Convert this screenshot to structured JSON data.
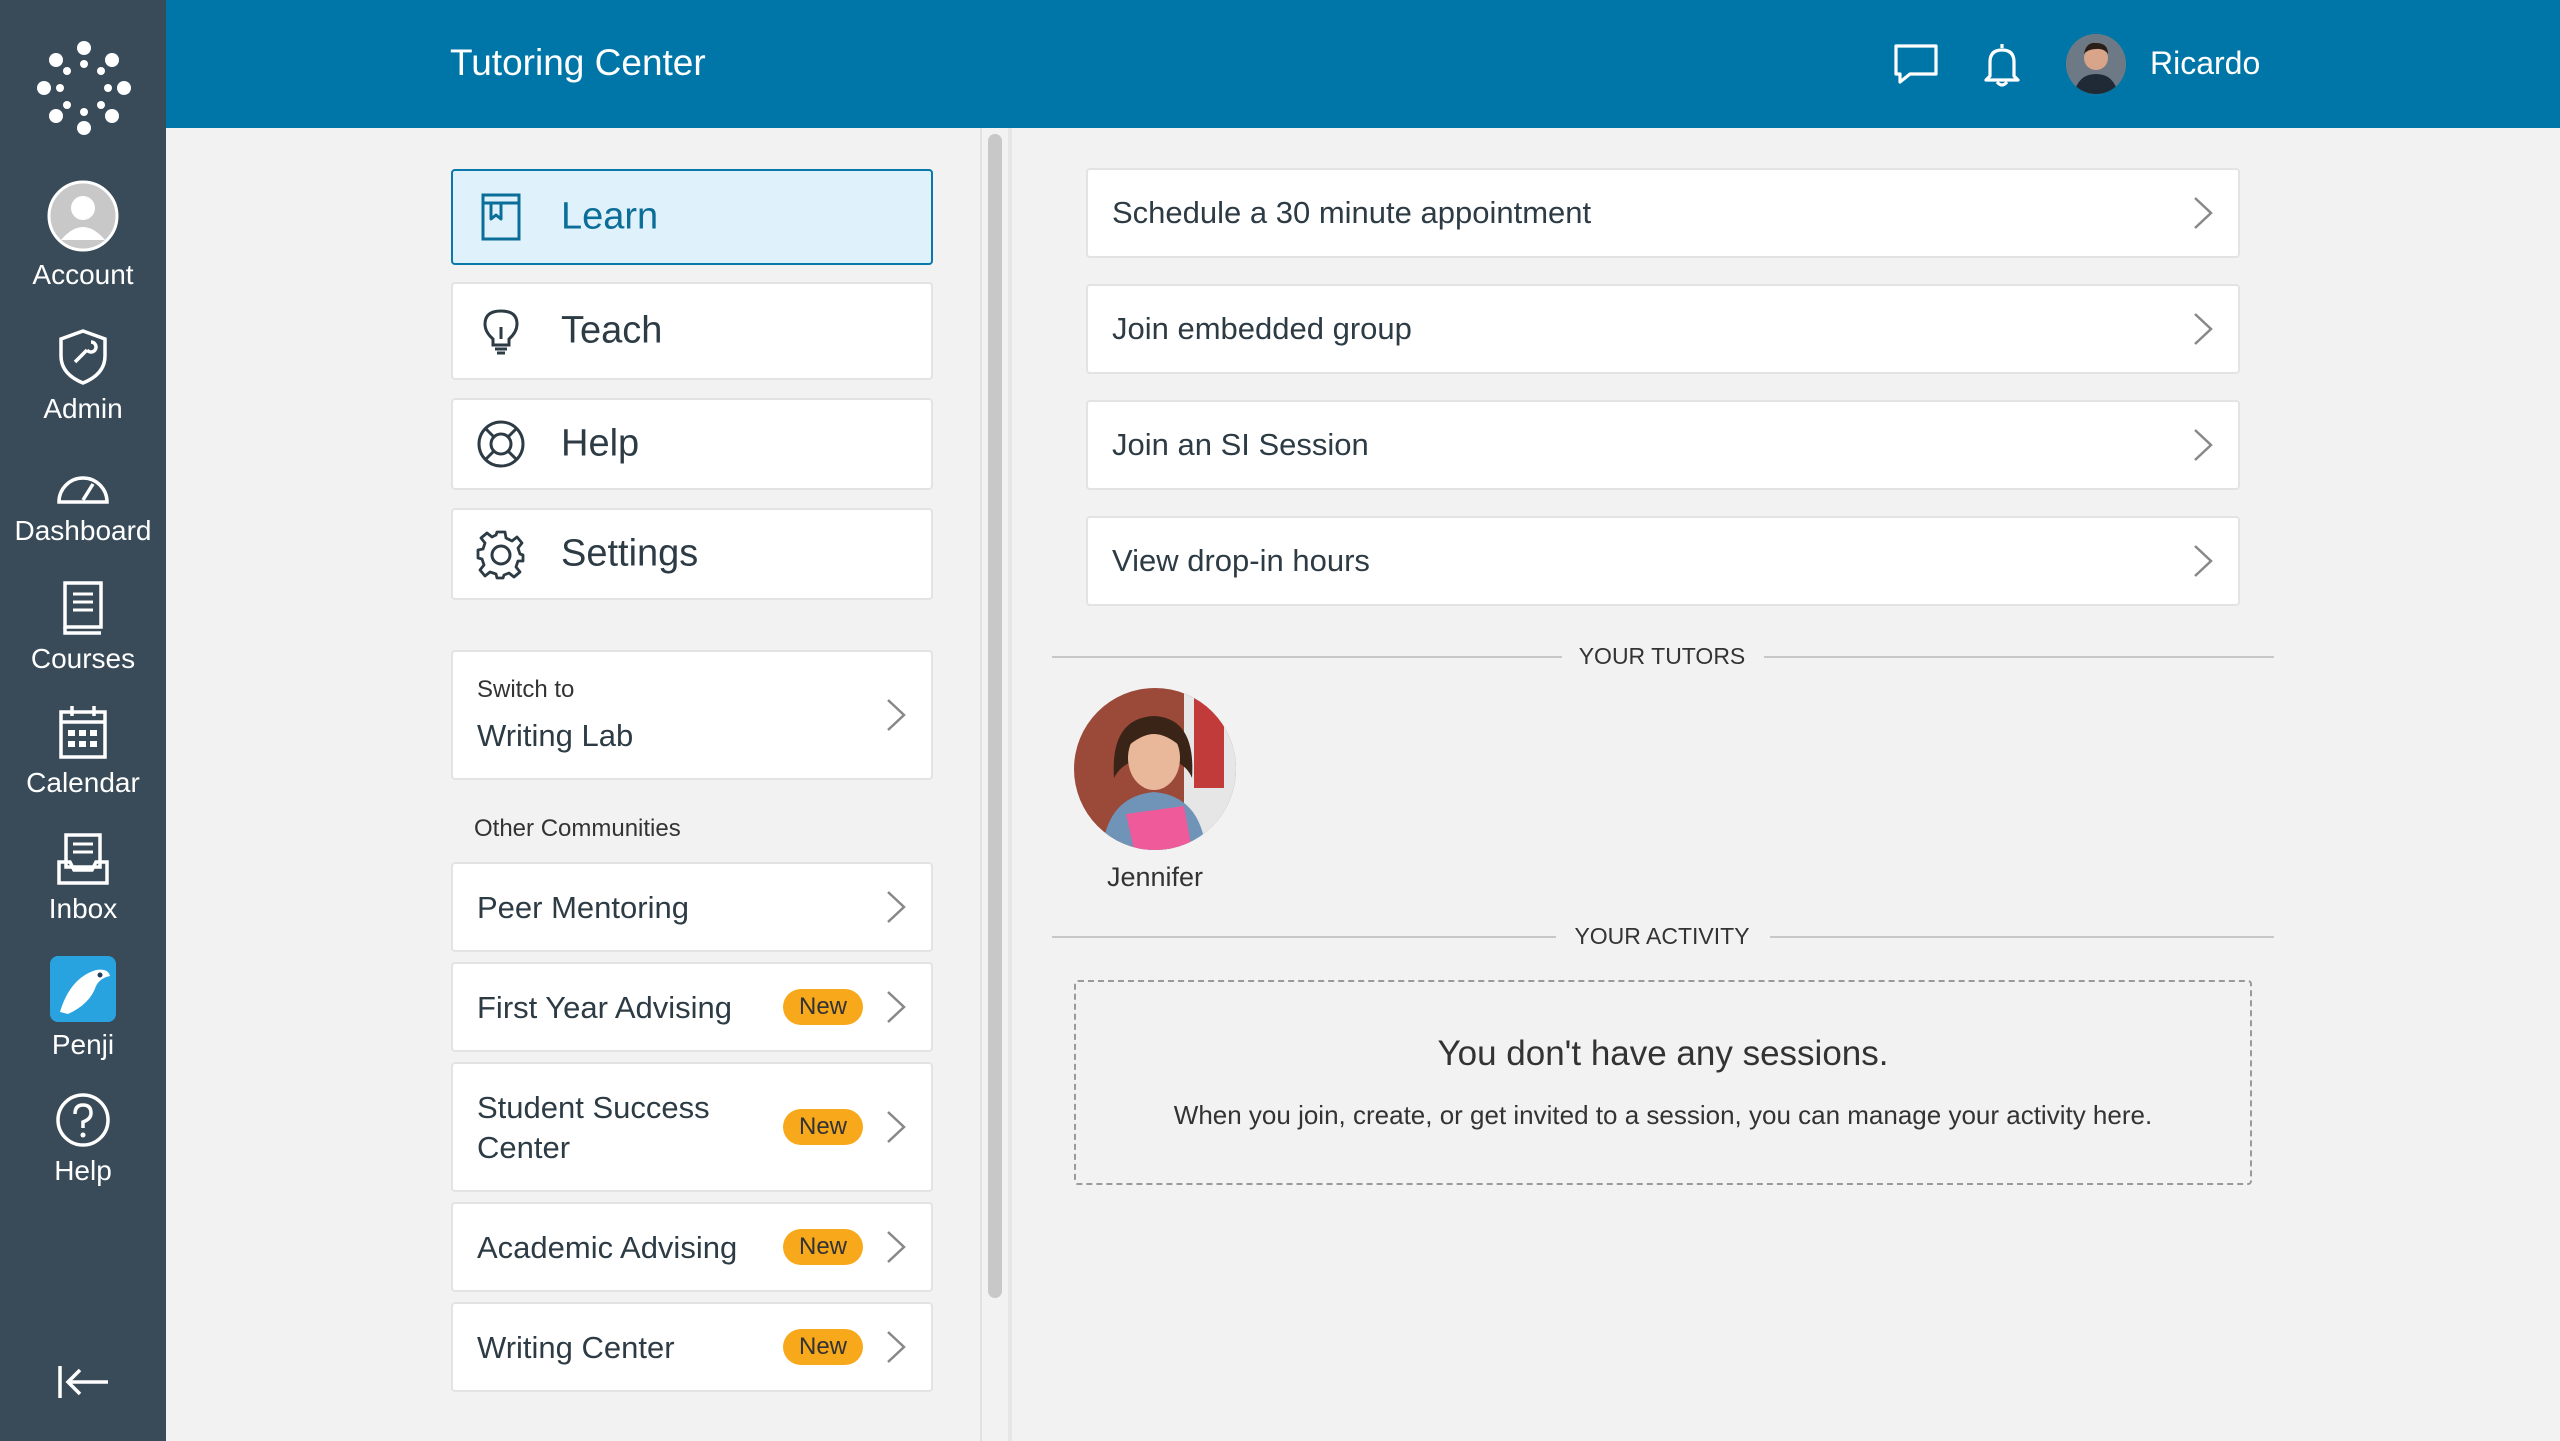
{
  "global_nav": {
    "items": [
      {
        "label": "Account",
        "icon": "user-avatar-icon"
      },
      {
        "label": "Admin",
        "icon": "shield-icon"
      },
      {
        "label": "Dashboard",
        "icon": "speedometer-icon"
      },
      {
        "label": "Courses",
        "icon": "book-icon"
      },
      {
        "label": "Calendar",
        "icon": "calendar-icon"
      },
      {
        "label": "Inbox",
        "icon": "inbox-icon"
      },
      {
        "label": "Penji",
        "icon": "penji-app-icon"
      },
      {
        "label": "Help",
        "icon": "question-circle-icon"
      }
    ],
    "collapse_icon": "collapse-left-icon"
  },
  "header": {
    "title": "Tutoring Center",
    "user_name": "Ricardo",
    "chat_icon": "chat-bubble-icon",
    "notification_icon": "bell-icon",
    "bg_color": "#0076a8"
  },
  "left_nav": {
    "items": [
      {
        "label": "Learn",
        "icon": "book-bookmark-icon",
        "active": true
      },
      {
        "label": "Teach",
        "icon": "lightbulb-icon",
        "active": false
      },
      {
        "label": "Help",
        "icon": "lifebuoy-icon",
        "active": false
      },
      {
        "label": "Settings",
        "icon": "gear-icon",
        "active": false
      }
    ]
  },
  "switch": {
    "small_label": "Switch to",
    "target": "Writing Lab"
  },
  "other_communities": {
    "heading": "Other Communities",
    "items": [
      {
        "label": "Peer Mentoring",
        "badge": ""
      },
      {
        "label": "First Year Advising",
        "badge": "New"
      },
      {
        "label": "Student Success Center",
        "badge": "New"
      },
      {
        "label": "Academic Advising",
        "badge": "New"
      },
      {
        "label": "Writing Center",
        "badge": "New"
      }
    ]
  },
  "actions": [
    {
      "label": "Schedule a 30 minute appointment"
    },
    {
      "label": "Join embedded group"
    },
    {
      "label": "Join an SI Session"
    },
    {
      "label": "View drop-in hours"
    }
  ],
  "tutors": {
    "heading": "YOUR TUTORS",
    "list": [
      {
        "name": "Jennifer"
      }
    ]
  },
  "activity": {
    "heading": "YOUR ACTIVITY",
    "empty_title": "You don't have any sessions.",
    "empty_subtitle": "When you join, create, or get invited to a session, you can manage your activity here."
  },
  "colors": {
    "accent": "#0076a8",
    "sidebar": "#394b58",
    "badge": "#f7a81b",
    "active_bg": "#dff1fb"
  }
}
